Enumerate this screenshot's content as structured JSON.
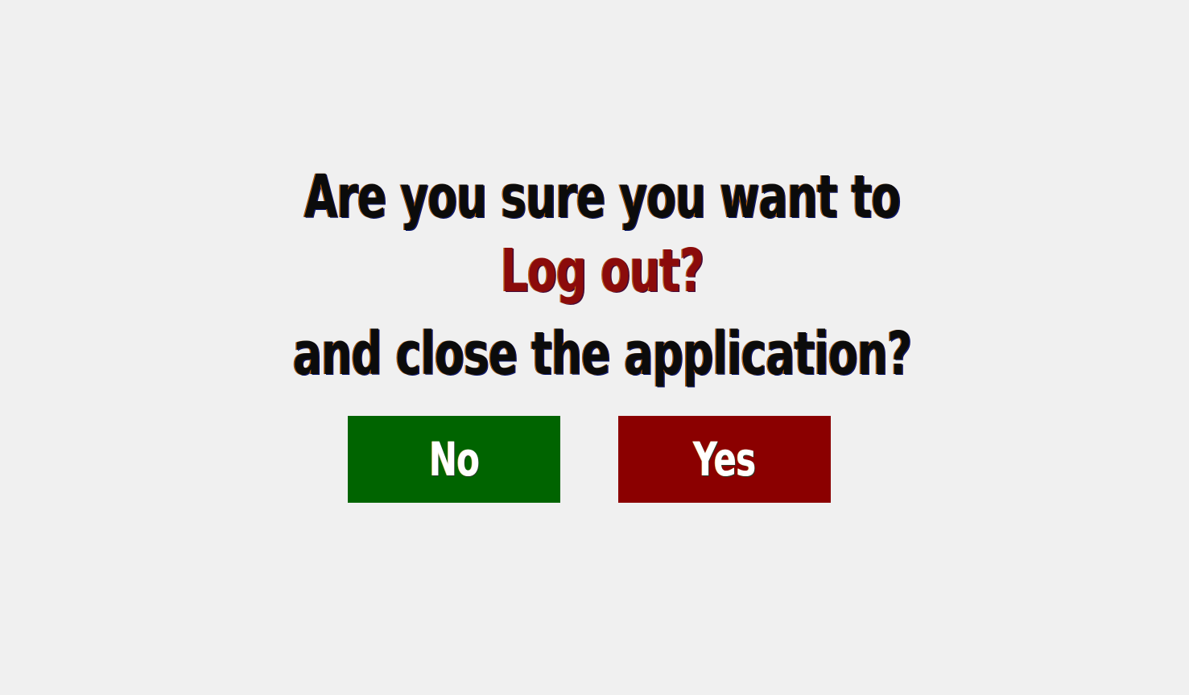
{
  "dialog": {
    "line1": "Are you sure you want to",
    "line2": "Log out?",
    "line3": "and close the application?",
    "no_label": "No",
    "yes_label": "Yes"
  },
  "colors": {
    "background": "#f0f0f0",
    "text": "#0b0b0b",
    "highlight_text": "#8b0b0b",
    "no_button": "#006400",
    "yes_button": "#8b0000",
    "button_text": "#ffffff"
  }
}
